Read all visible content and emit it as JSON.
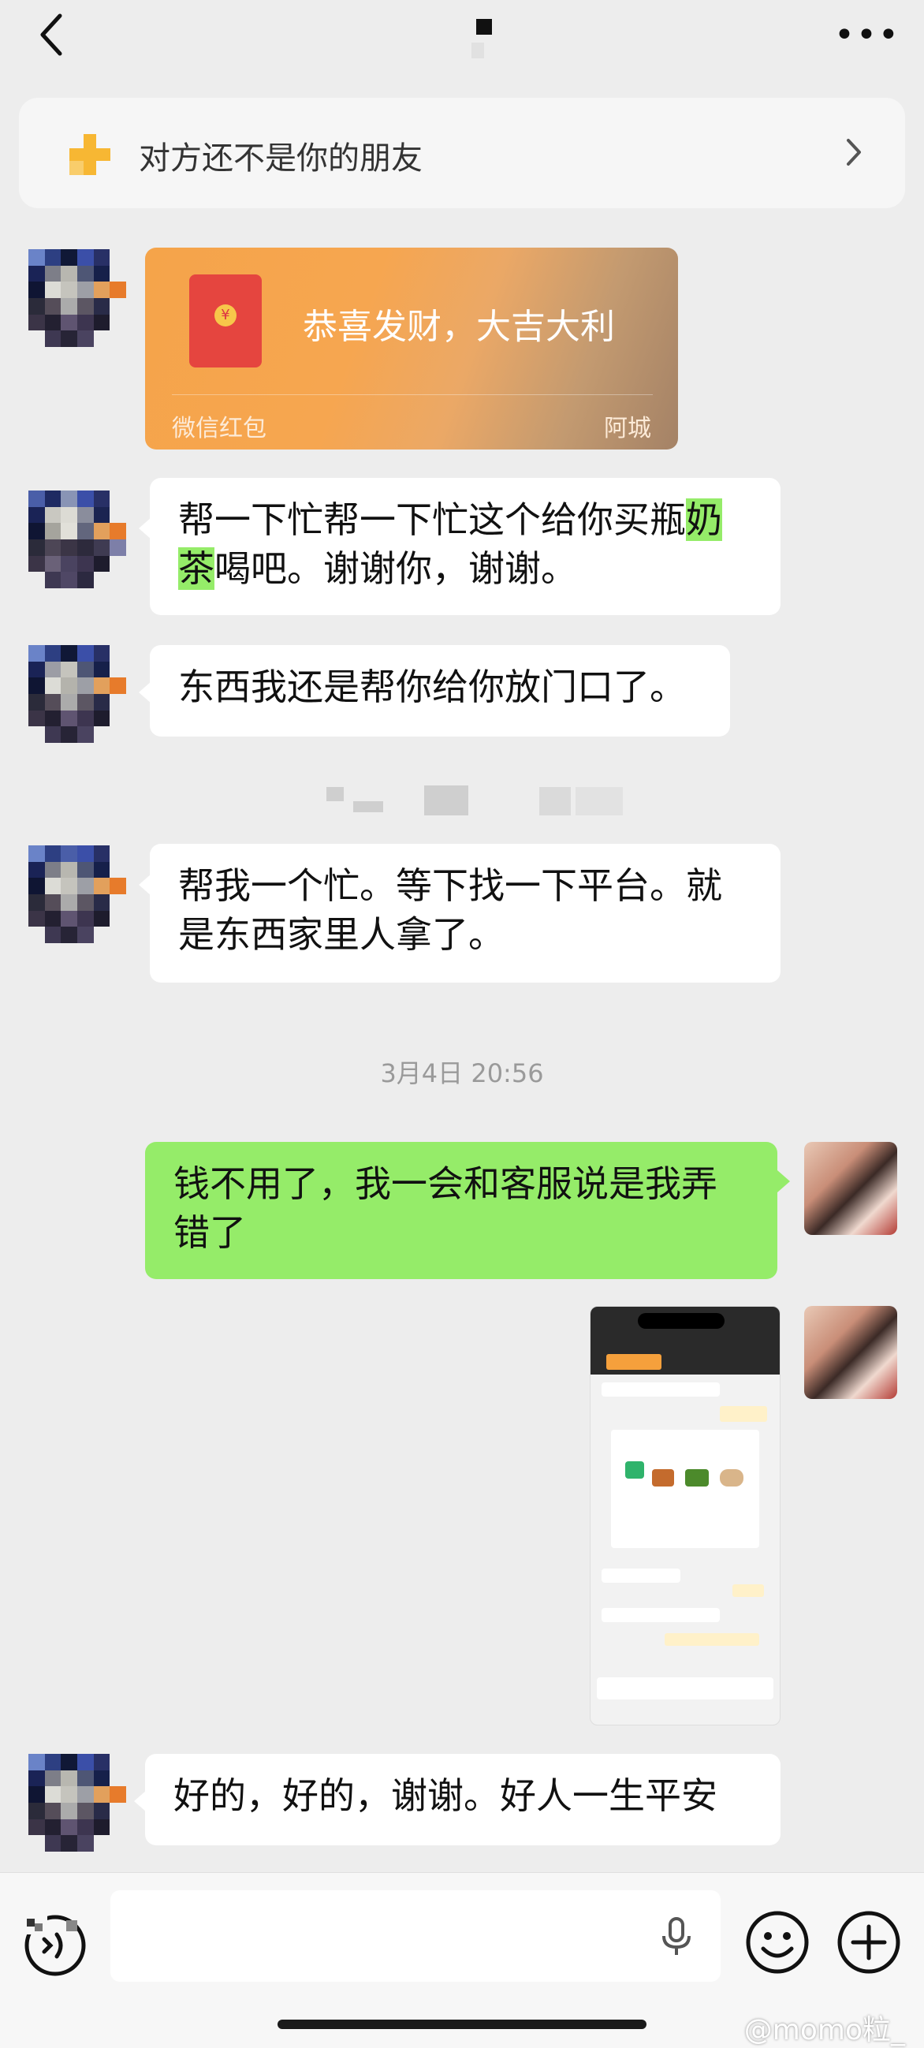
{
  "banner": {
    "text": "对方还不是你的朋友"
  },
  "messages": {
    "redpacket": {
      "greeting": "恭喜发财，大吉大利",
      "label": "微信红包",
      "sender": "阿城"
    },
    "m1": {
      "part1": "帮一下忙帮一下忙这个给你买瓶",
      "hl1": "奶",
      "hl2": "茶",
      "part2": "喝吧。谢谢你，谢谢。"
    },
    "m2": "东西我还是帮你给你放门口了。",
    "m3_line1": "帮我一个忙。等下找一下平台。就",
    "m3_line2": "是东西家里人拿了。",
    "timestamp": "3月4日 20:56",
    "m4_line1": "钱不用了，我一会和客服说是我弄",
    "m4_line2": "错了",
    "m5": "好的，好的，谢谢。好人一生平安"
  },
  "watermark": "@momo粒_",
  "colors": {
    "my_bubble": "#95ec69",
    "background": "#ededed",
    "redpacket": "#f5a44a"
  }
}
